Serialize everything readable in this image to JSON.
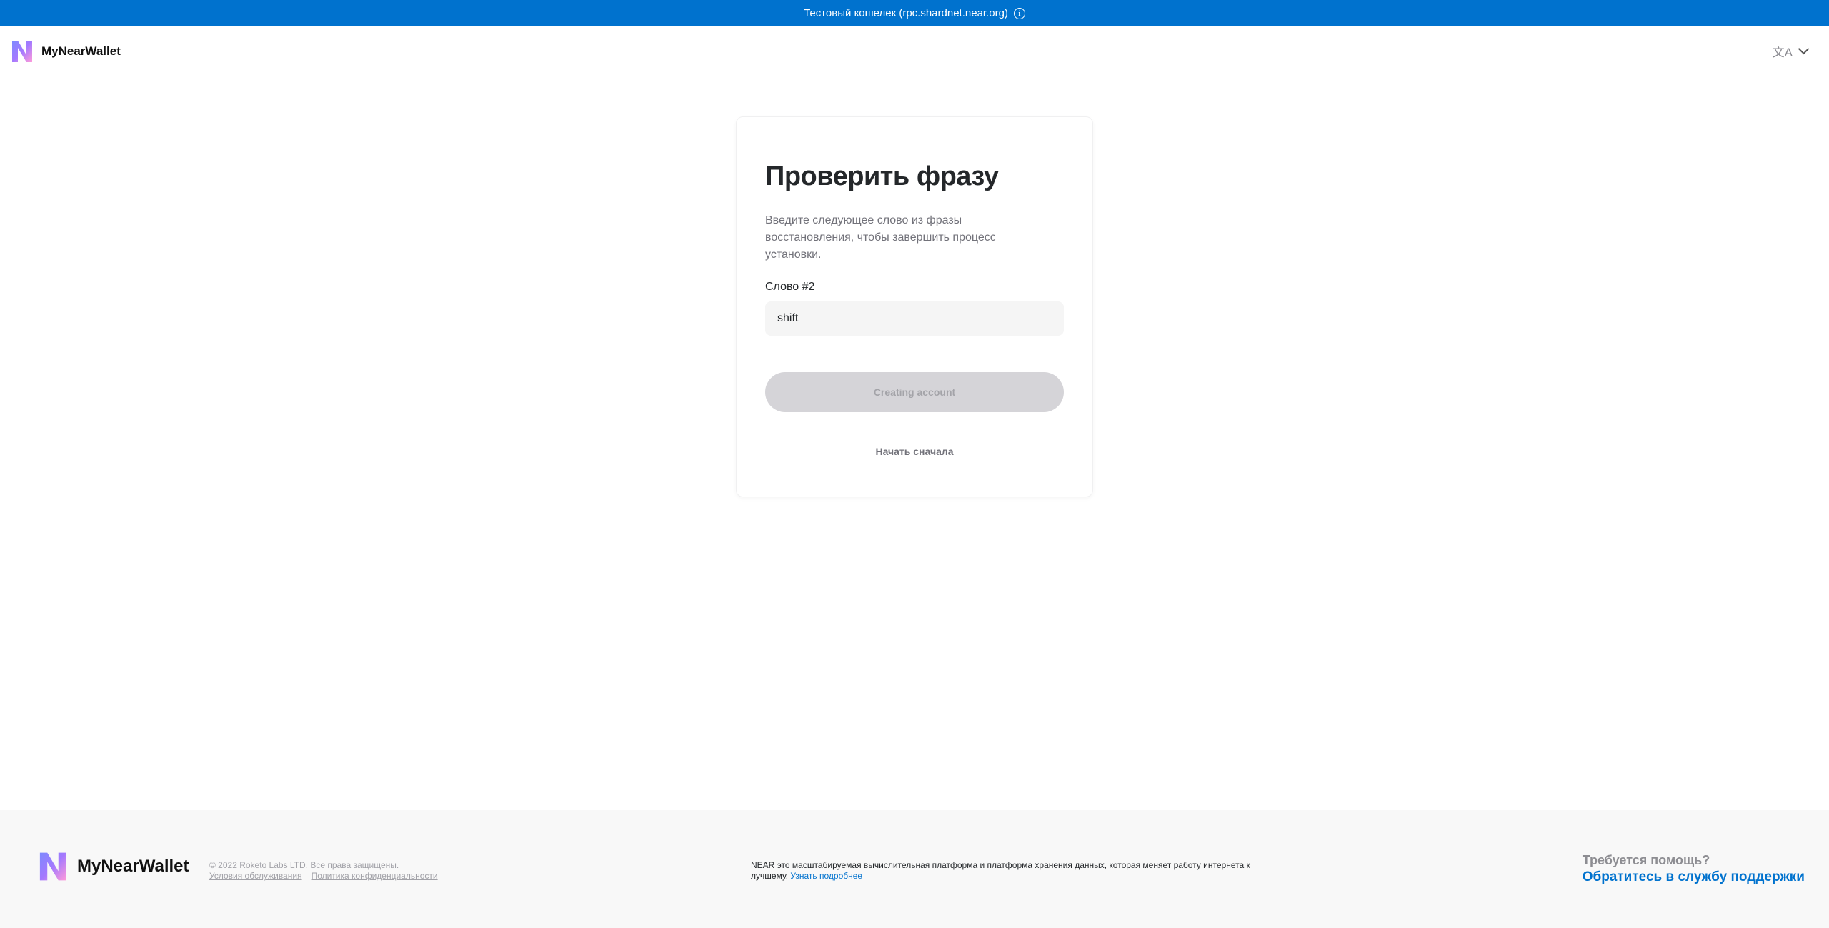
{
  "banner": {
    "text": "Тестовый кошелек (rpc.shardnet.near.org)",
    "info_icon": "info-icon"
  },
  "header": {
    "brand": "MyNearWallet",
    "logo_icon": "near-logo-icon",
    "language_icon": "translate-icon",
    "chevron_icon": "chevron-down-icon"
  },
  "card": {
    "title": "Проверить фразу",
    "description": "Введите следующее слово из фразы восстановления, чтобы завершить процесс установки.",
    "word_label": "Слово #2",
    "word_value": "shift",
    "submit_label": "Creating account",
    "restart_label": "Начать сначала"
  },
  "footer": {
    "brand": "MyNearWallet",
    "copyright": "© 2022 Roketo Labs LTD. Все права защищены.",
    "terms_link": "Условия обслуживания",
    "privacy_link": "Политика конфиденциальности",
    "about_text": "NEAR это масштабируемая вычислительная платформа и платформа хранения данных, которая меняет работу интернета к лучшему.",
    "learn_more_link": "Узнать подробнее",
    "help_question": "Требуется помощь?",
    "support_link": "Обратитесь в службу поддержки"
  },
  "colors": {
    "accent": "#0072ce",
    "button_disabled": "#d5d4d8",
    "text_primary": "#24272a",
    "text_secondary": "#72727a"
  }
}
